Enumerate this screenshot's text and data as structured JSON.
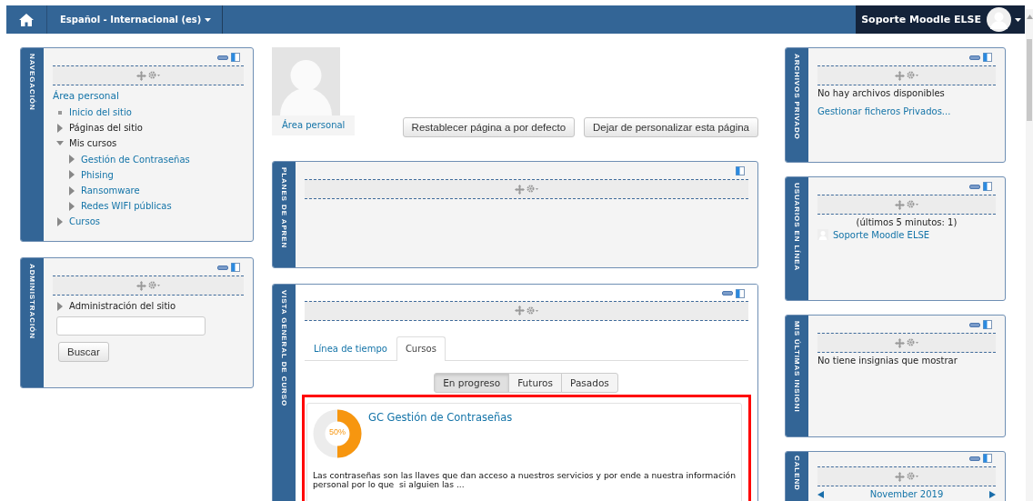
{
  "navbar": {
    "language": "Español - Internacional (es)",
    "user": "Soporte Moodle ELSE"
  },
  "left_blocks": [
    {
      "kind": "navigation",
      "title": "NAVEGACIÓN",
      "collapse_icon": true,
      "home": "Área personal",
      "tree": [
        {
          "kind": "leaf",
          "label": "Inicio del sitio",
          "link": true
        },
        {
          "kind": "branch",
          "label": "Páginas del sitio",
          "link": false,
          "expanded": false
        },
        {
          "kind": "branch",
          "label": "Mis cursos",
          "link": false,
          "expanded": true,
          "children": [
            {
              "kind": "branch",
              "label": "Gestión de Contraseñas",
              "link": true,
              "expanded": false
            },
            {
              "kind": "branch",
              "label": "Phising",
              "link": true,
              "expanded": false
            },
            {
              "kind": "branch",
              "label": "Ransomware",
              "link": true,
              "expanded": false
            },
            {
              "kind": "branch",
              "label": "Redes WIFI públicas",
              "link": true,
              "expanded": false
            }
          ]
        },
        {
          "kind": "branch",
          "label": "Cursos",
          "link": true,
          "expanded": false
        }
      ]
    },
    {
      "kind": "admin",
      "title": "ADMINISTRACIÓN",
      "collapse_icon": true,
      "tree": [
        {
          "kind": "branch",
          "label": "Administración del sitio",
          "link": false,
          "expanded": false
        }
      ],
      "search_button": "Buscar"
    }
  ],
  "profile": {
    "caption": "Área personal",
    "buttons": [
      "Restablecer página a por defecto",
      "Dejar de personalizar esta página"
    ]
  },
  "center_blocks": [
    {
      "kind": "plans",
      "title": "PLANES DE APREN",
      "collapse_icon": false
    },
    {
      "kind": "overview",
      "title": "VISTA GENERAL DE CURSO",
      "collapse_icon": true,
      "tabs": [
        {
          "label": "Línea de tiempo",
          "selected": false
        },
        {
          "label": "Cursos",
          "selected": true
        }
      ],
      "filters": [
        {
          "label": "En progreso",
          "selected": true
        },
        {
          "label": "Futuros",
          "selected": false
        },
        {
          "label": "Pasados",
          "selected": false
        }
      ],
      "courses": [
        {
          "title": "GC Gestión de Contraseñas",
          "progress": "50%",
          "level": 0.5,
          "summary": "Las contraseñas son las llaves que dan acceso a nuestros servicios y por ende a nuestra información personal por lo que  si alguien las ..."
        }
      ]
    }
  ],
  "right_blocks": [
    {
      "kind": "files",
      "title": "ARCHIVOS PRIVADO",
      "collapse_icon": true,
      "message": "No hay archivos disponibles",
      "link": "Gestionar ficheros Privados..."
    },
    {
      "kind": "users",
      "title": "USUARIOS EN LÍNEA",
      "collapse_icon": true,
      "period": "(últimos 5 minutos: 1)",
      "users": [
        "Soporte Moodle ELSE"
      ]
    },
    {
      "kind": "badges",
      "title": "MIS ÚLTIMAS INSIGNI",
      "collapse_icon": true,
      "message": "No tiene insignias que mostrar"
    },
    {
      "kind": "calendar",
      "title": "CALEND",
      "collapse_icon": true,
      "month": "November 2019"
    }
  ]
}
